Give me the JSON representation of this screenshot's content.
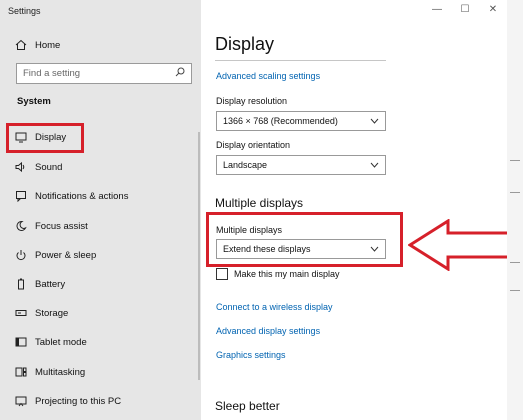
{
  "window": {
    "app_title": "Settings",
    "controls": [
      "—",
      "☐",
      "✕"
    ]
  },
  "sidebar": {
    "home": "Home",
    "search_placeholder": "Find a setting",
    "section": "System",
    "items": [
      {
        "label": "Display",
        "icon": "monitor-icon",
        "selected": true
      },
      {
        "label": "Sound",
        "icon": "speaker-icon"
      },
      {
        "label": "Notifications & actions",
        "icon": "notification-icon"
      },
      {
        "label": "Focus assist",
        "icon": "moon-icon"
      },
      {
        "label": "Power & sleep",
        "icon": "power-icon"
      },
      {
        "label": "Battery",
        "icon": "battery-icon"
      },
      {
        "label": "Storage",
        "icon": "storage-icon"
      },
      {
        "label": "Tablet mode",
        "icon": "tablet-icon"
      },
      {
        "label": "Multitasking",
        "icon": "multitasking-icon"
      },
      {
        "label": "Projecting to this PC",
        "icon": "projector-icon"
      }
    ]
  },
  "main": {
    "title": "Display",
    "advanced_scaling_link": "Advanced scaling settings",
    "resolution": {
      "label": "Display resolution",
      "value": "1366 × 768 (Recommended)"
    },
    "orientation": {
      "label": "Display orientation",
      "value": "Landscape"
    },
    "multiple_displays_heading": "Multiple displays",
    "multiple_displays": {
      "label": "Multiple displays",
      "value": "Extend these displays"
    },
    "main_display_checkbox": {
      "label": "Make this my main display",
      "checked": false
    },
    "links": {
      "wireless": "Connect to a wireless display",
      "advanced_display": "Advanced display settings",
      "graphics": "Graphics settings"
    },
    "sleep_heading": "Sleep better"
  },
  "colors": {
    "accent_link": "#0063b1",
    "highlight_red": "#d6202a",
    "sidebar_bg": "#e6e6e6"
  }
}
